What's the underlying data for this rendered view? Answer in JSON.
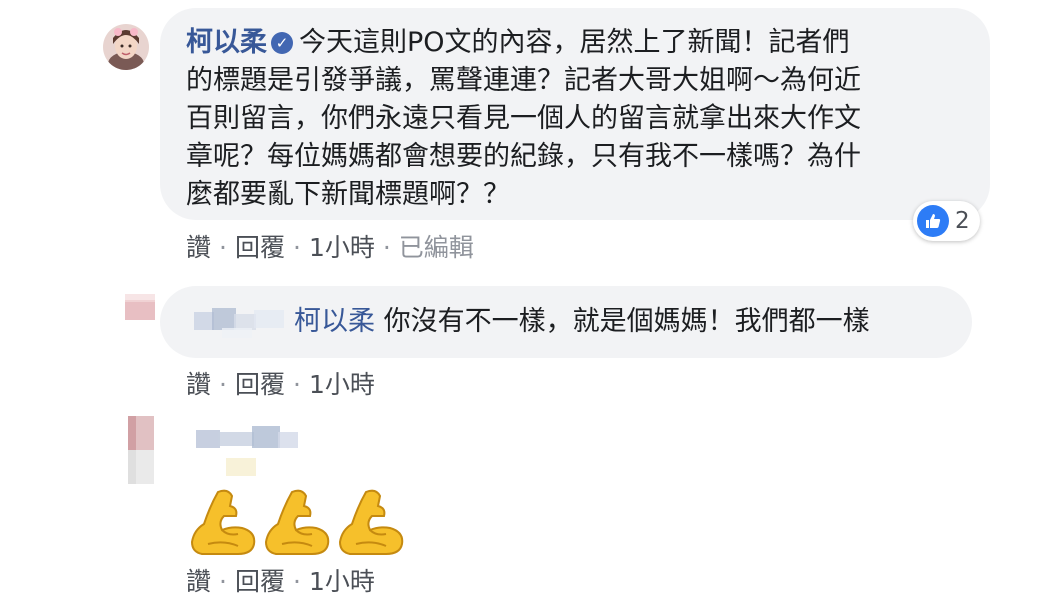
{
  "comments": [
    {
      "author": "柯以柔",
      "text_lines": [
        "今天這則PO文的內容，居然上了新聞！記者們",
        "的標題是引發爭議，罵聲連連？記者大哥大姐啊～為何近",
        "百則留言，你們永遠只看見一個人的留言就拿出來大作文",
        "章呢？每位媽媽都會想要的紀錄，只有我不一樣嗎？為什",
        "麼都要亂下新聞標題啊？？"
      ],
      "reaction_count": "2",
      "actions": {
        "like": "讚",
        "reply": "回覆",
        "time": "1小時",
        "edited": "已編輯"
      }
    },
    {
      "author": "",
      "mention": "柯以柔",
      "text": "你沒有不一樣，就是個媽媽！我們都一樣",
      "actions": {
        "like": "讚",
        "reply": "回覆",
        "time": "1小時"
      }
    },
    {
      "author": "",
      "emoji": [
        "flexed-biceps",
        "flexed-biceps",
        "flexed-biceps"
      ],
      "actions": {
        "like": "讚",
        "reply": "回覆",
        "time": "1小時"
      }
    }
  ],
  "colors": {
    "link": "#385898",
    "bubble": "#f2f3f5",
    "like_blue": "#2d7cf6"
  }
}
